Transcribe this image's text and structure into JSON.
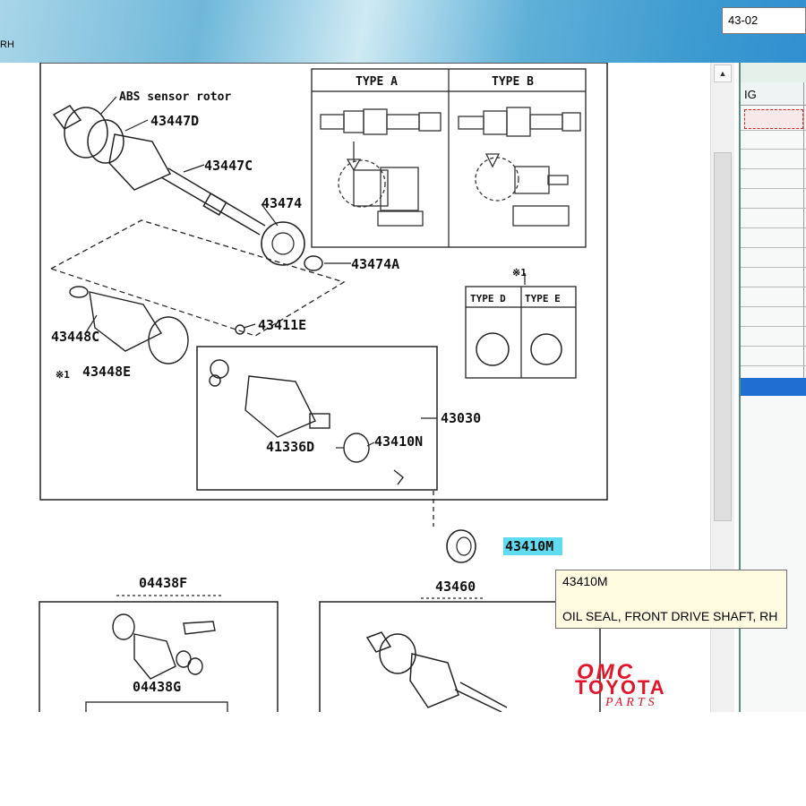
{
  "window": {
    "title_fragment": "RH",
    "search_value": "43-02"
  },
  "diagram": {
    "labels": {
      "abs_sensor_rotor": "ABS sensor rotor",
      "p43447D": "43447D",
      "p43447C": "43447C",
      "p43474": "43474",
      "p43474A": "43474A",
      "p43448C": "43448C",
      "p43448E": "43448E",
      "p43411E": "43411E",
      "p43030": "43030",
      "p41336D": "41336D",
      "p43410N": "43410N",
      "p43410M": "43410M",
      "p04438F": "04438F",
      "p04438G": "04438G",
      "p43460": "43460",
      "note_star1_a": "※1",
      "note_star1_b": "※1"
    },
    "type_boxes": {
      "type_a": "TYPE A",
      "type_b": "TYPE B",
      "type_d": "TYPE D",
      "type_e": "TYPE E"
    },
    "highlight_color": "#5fdcf0"
  },
  "right_panel": {
    "column_header": "IG",
    "selection_color": "#1f6fd0"
  },
  "tooltip": {
    "part_number": "43410M",
    "description": "OIL SEAL, FRONT DRIVE SHAFT, RH"
  },
  "logo": {
    "line1": "OMC",
    "line2": "TOYOTA",
    "line3": "PARTS",
    "color": "#e3152a"
  }
}
